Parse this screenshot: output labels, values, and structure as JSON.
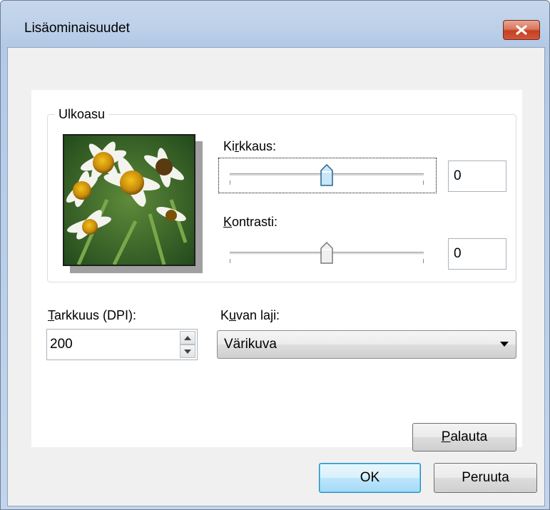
{
  "window": {
    "title": "Lisäominaisuudet",
    "close_icon": "close-icon"
  },
  "appearance": {
    "group_label": "Ulkoasu",
    "brightness": {
      "label_pre": "Ki",
      "label_accel": "r",
      "label_post": "kkaus:",
      "value": "0",
      "slider_level": 0.5
    },
    "contrast": {
      "label_pre": "",
      "label_accel": "K",
      "label_post": "ontrasti:",
      "value": "0",
      "slider_level": 0.5
    }
  },
  "resolution": {
    "label_accel": "T",
    "label_post": "arkkuus (DPI):",
    "value": "200"
  },
  "picture_type": {
    "label_pre": "K",
    "label_accel": "u",
    "label_post": "van laji:",
    "selected": "Värikuva"
  },
  "buttons": {
    "reset_accel": "P",
    "reset_post": "alauta",
    "ok": "OK",
    "cancel": "Peruuta"
  },
  "colors": {
    "accent": "#3c7fb1",
    "close": "#c4401f"
  }
}
